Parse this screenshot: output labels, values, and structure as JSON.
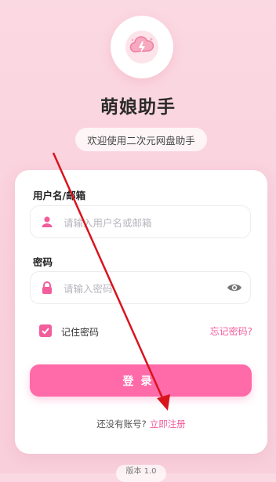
{
  "app": {
    "title": "萌娘助手",
    "subtitle": "欢迎使用二次元网盘助手"
  },
  "form": {
    "username_label": "用户名/邮箱",
    "username_placeholder": "请输入用户名或邮箱",
    "password_label": "密码",
    "password_placeholder": "请输入密码",
    "remember_label": "记住密码",
    "remember_checked": true,
    "forgot_label": "忘记密码?",
    "login_label": "登录",
    "no_account_label": "还没有账号?",
    "register_label": "立即注册"
  },
  "footer": {
    "version": "版本 1.0"
  },
  "colors": {
    "accent": "#f25d9c",
    "button": "#ff6aa9",
    "background": "#f9d1dd",
    "annotation_arrow": "#d9141c"
  },
  "icons": {
    "logo": "cloud-bolt-icon",
    "username": "user-icon",
    "password": "lock-icon",
    "toggle_visibility": "eye-icon",
    "checkbox": "check-icon"
  }
}
